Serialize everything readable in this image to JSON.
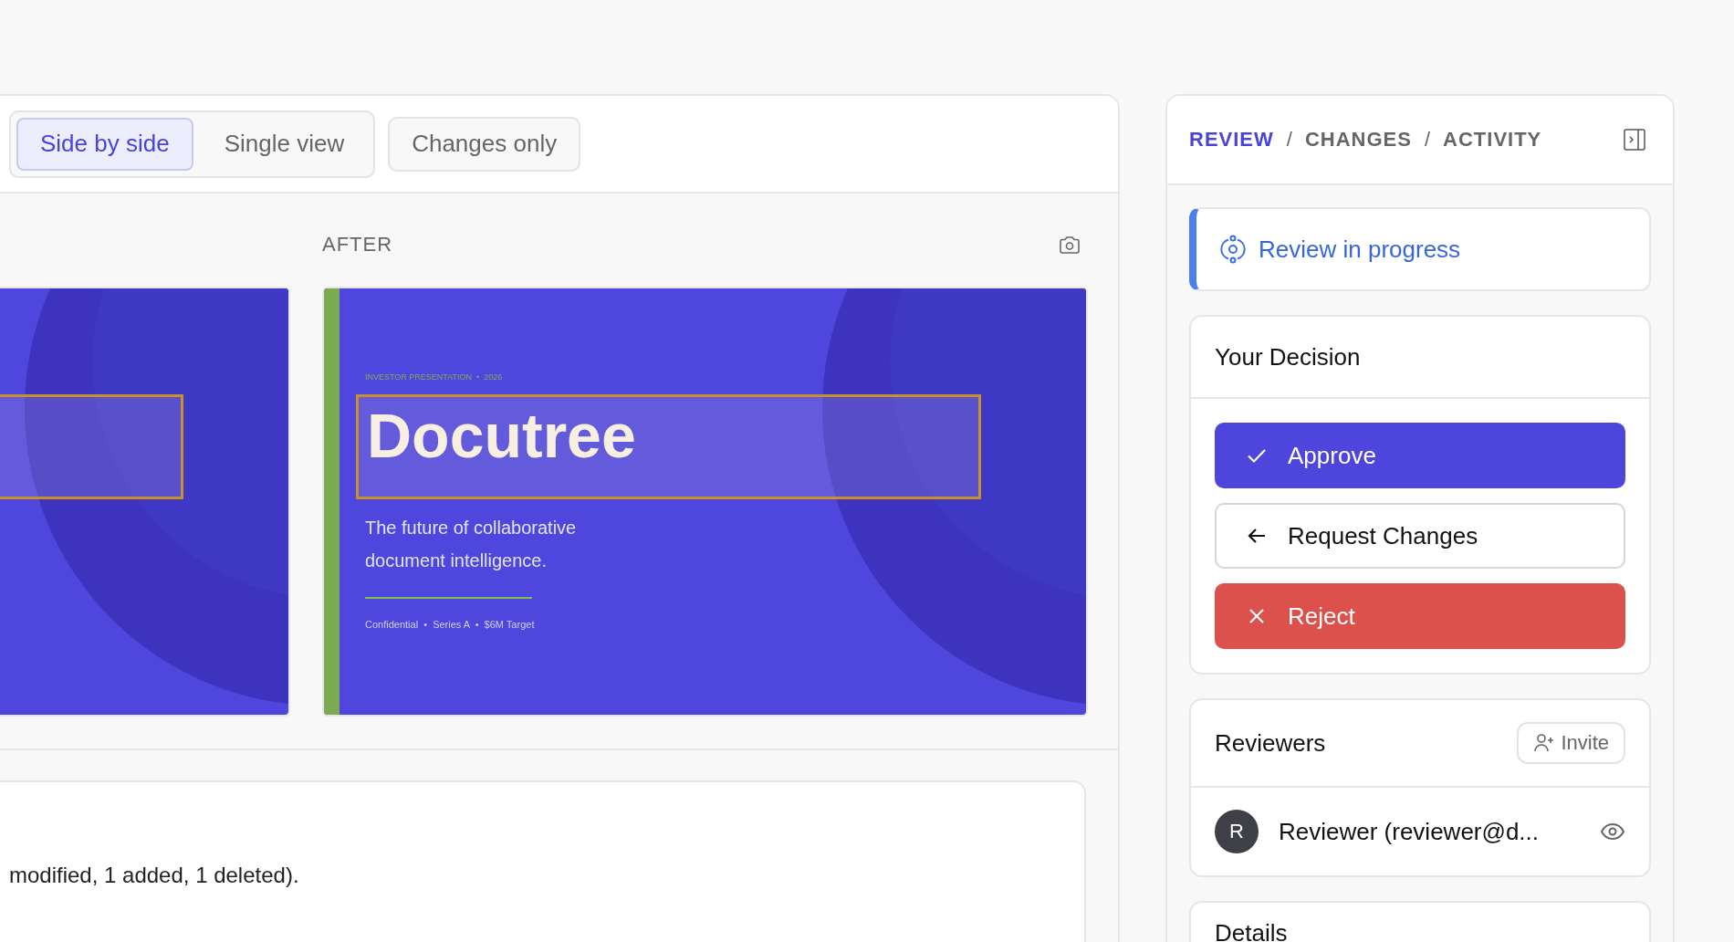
{
  "view_modes": [
    {
      "label": "Side by side",
      "selected": true
    },
    {
      "label": "Single view",
      "selected": false
    }
  ],
  "changes_only": {
    "label": "Changes only",
    "on": false
  },
  "compare": {
    "after_label": "AFTER",
    "after_slide": {
      "eyebrow": "INVESTOR PRESENTATION  •  2026",
      "title": "Docutree",
      "subtitle": "The future of collaborative document intelligence.",
      "footer": "Confidential  •  Series A  •  $6M Target"
    }
  },
  "summary": {
    "text": "modified, 1 added, 1 deleted)."
  },
  "side_panel": {
    "tabs": [
      {
        "label": "REVIEW",
        "selected": true
      },
      {
        "label": "CHANGES",
        "selected": false
      },
      {
        "label": "ACTIVITY",
        "selected": false
      }
    ],
    "separators": [
      "/",
      "/"
    ],
    "status": {
      "label": "Review in progress"
    },
    "decision": {
      "title": "Your Decision",
      "actions": [
        {
          "kind": "approve",
          "label": "Approve"
        },
        {
          "kind": "request",
          "label": "Request Changes"
        },
        {
          "kind": "reject",
          "label": "Reject"
        }
      ]
    },
    "reviewers": {
      "title": "Reviewers",
      "invite": "Invite",
      "list": [
        {
          "initial": "R",
          "name": "Reviewer (reviewer@d..."
        }
      ]
    },
    "details": {
      "title": "Details"
    }
  }
}
